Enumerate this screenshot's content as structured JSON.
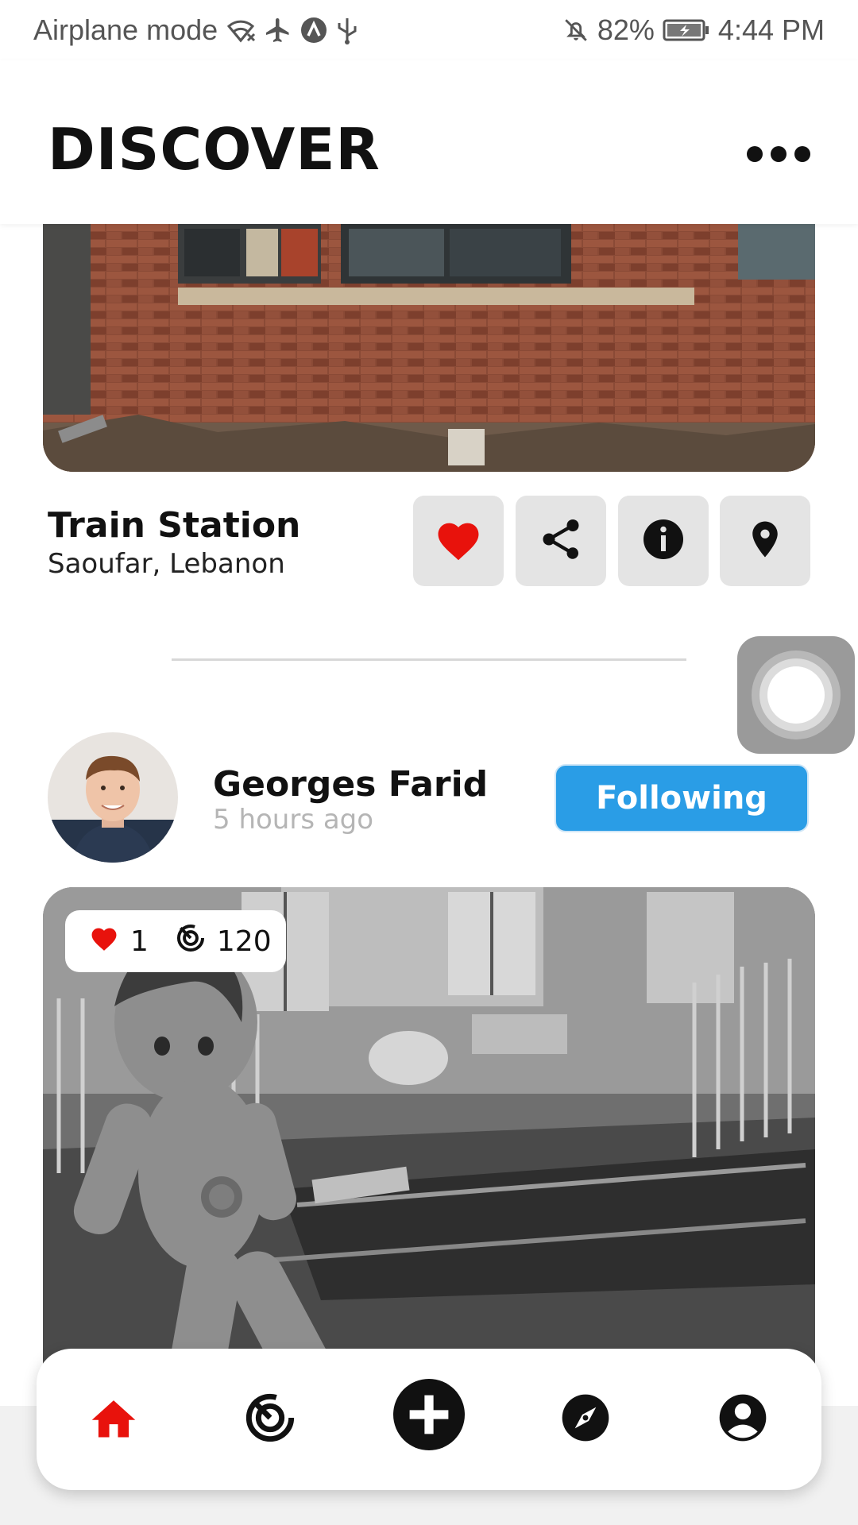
{
  "status_bar": {
    "left_text": "Airplane mode",
    "battery": "82%",
    "time": "4:44 PM",
    "icons": [
      "wifi-icon",
      "airplane-icon",
      "app-a-icon",
      "usb-icon",
      "notifications-off-icon",
      "battery-charging-icon"
    ]
  },
  "header": {
    "title": "DISCOVER",
    "more_icon": "more-horizontal-icon"
  },
  "place": {
    "name": "Train Station",
    "location": "Saoufar, Lebanon",
    "actions": [
      "heart-icon",
      "share-icon",
      "info-icon",
      "location-pin-icon"
    ]
  },
  "post": {
    "author": "Georges Farid",
    "time": "5 hours ago",
    "follow_label": "Following",
    "likes": "1",
    "views": "120"
  },
  "bottom_nav": {
    "items": [
      "home-icon",
      "radar-icon",
      "add-icon",
      "compass-icon",
      "profile-icon"
    ],
    "active": "home-icon"
  },
  "colors": {
    "accent_red": "#e8120c",
    "follow_blue": "#2a9de6",
    "action_bg": "#e4e4e4"
  }
}
